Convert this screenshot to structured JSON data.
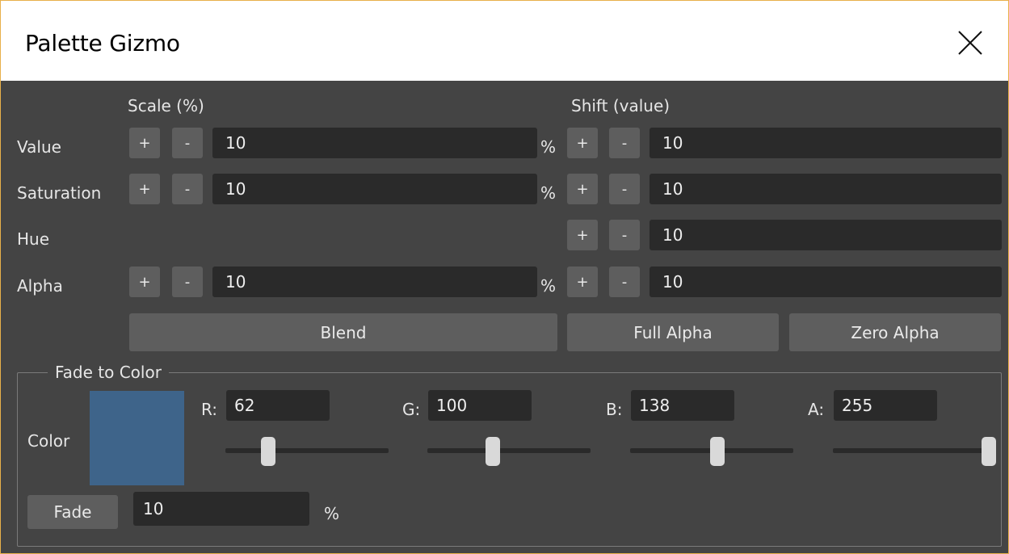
{
  "window": {
    "title": "Palette Gizmo"
  },
  "headers": {
    "scale": "Scale (%)",
    "shift": "Shift (value)"
  },
  "rows": [
    {
      "label": "Value",
      "scale_value": "10",
      "shift_value": "10",
      "pct": "%"
    },
    {
      "label": "Saturation",
      "scale_value": "10",
      "shift_value": "10",
      "pct": "%"
    },
    {
      "label": "Hue",
      "shift_value": "10"
    },
    {
      "label": "Alpha",
      "scale_value": "10",
      "shift_value": "10",
      "pct": "%"
    }
  ],
  "buttons": {
    "plus": "+",
    "minus": "-",
    "blend": "Blend",
    "full_alpha": "Full Alpha",
    "zero_alpha": "Zero Alpha",
    "fade": "Fade"
  },
  "fade_group": {
    "title": "Fade to Color",
    "color_label": "Color",
    "swatch_color": "#3e648a",
    "channels": [
      {
        "label": "R:",
        "value": "62",
        "level": 0.24
      },
      {
        "label": "G:",
        "value": "100",
        "level": 0.39
      },
      {
        "label": "B:",
        "value": "138",
        "level": 0.54
      },
      {
        "label": "A:",
        "value": "255",
        "level": 1.0
      }
    ],
    "fade_value": "10",
    "fade_pct": "%"
  }
}
